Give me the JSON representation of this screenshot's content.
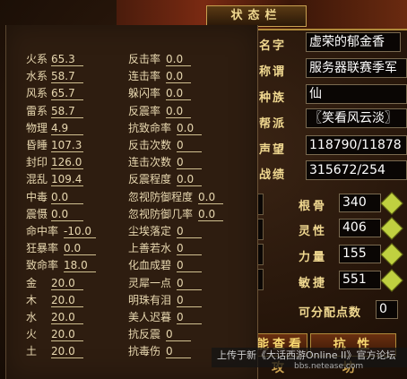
{
  "status_panel": {
    "title": "状态栏",
    "info": [
      {
        "label": "名字",
        "value": "虚荣的郁金香"
      },
      {
        "label": "称谓",
        "value": "服务器联赛季军"
      },
      {
        "label": "种族",
        "value": "仙"
      },
      {
        "label": "帮派",
        "value": "〖笑看风云淡〗"
      },
      {
        "label": "声望",
        "value": "118790/11878"
      },
      {
        "label": "战绩",
        "value": "315672/254"
      }
    ],
    "attributes": [
      {
        "label": "根骨",
        "value": "340"
      },
      {
        "label": "灵性",
        "value": "406"
      },
      {
        "label": "力量",
        "value": "155"
      },
      {
        "label": "敏捷",
        "value": "551"
      }
    ],
    "free_points": {
      "label": "可分配点数",
      "value": "0"
    },
    "buttons": {
      "view": "能查看",
      "resist": "抗 性"
    },
    "bottom_text": "攻 坊"
  },
  "resist_popup": {
    "left_column": [
      {
        "label": "火系",
        "value": "65.3"
      },
      {
        "label": "水系",
        "value": "58.7"
      },
      {
        "label": "风系",
        "value": "65.7"
      },
      {
        "label": "雷系",
        "value": "58.7"
      },
      {
        "label": "物理",
        "value": "4.9"
      },
      {
        "label": "昏睡",
        "value": "107.3"
      },
      {
        "label": "封印",
        "value": "126.0"
      },
      {
        "label": "混乱",
        "value": "109.4"
      },
      {
        "label": "中毒",
        "value": "0.0"
      },
      {
        "label": "震慑",
        "value": "0.0"
      },
      {
        "label": "命中率",
        "value": "-10.0"
      },
      {
        "label": "狂暴率",
        "value": "0.0"
      },
      {
        "label": "致命率",
        "value": "18.0"
      },
      {
        "label": "金",
        "value": "20.0"
      },
      {
        "label": "木",
        "value": "20.0"
      },
      {
        "label": "水",
        "value": "20.0"
      },
      {
        "label": "火",
        "value": "20.0"
      },
      {
        "label": "土",
        "value": "20.0"
      }
    ],
    "right_column": [
      {
        "label": "反击率",
        "value": "0.0"
      },
      {
        "label": "连击率",
        "value": "0.0"
      },
      {
        "label": "躲闪率",
        "value": "0.0"
      },
      {
        "label": "反震率",
        "value": "0.0"
      },
      {
        "label": "抗致命率",
        "value": "0.0"
      },
      {
        "label": "反击次数",
        "value": "0"
      },
      {
        "label": "连击次数",
        "value": "0"
      },
      {
        "label": "反震程度",
        "value": "0.0"
      },
      {
        "label": "忽视防御程度",
        "value": "0.0"
      },
      {
        "label": "忽视防御几率",
        "value": "0.0"
      },
      {
        "label": "尘埃落定",
        "value": "0"
      },
      {
        "label": "上善若水",
        "value": "0"
      },
      {
        "label": "化血成碧",
        "value": "0"
      },
      {
        "label": "灵犀一点",
        "value": "0"
      },
      {
        "label": "明珠有泪",
        "value": "0"
      },
      {
        "label": "美人迟暮",
        "value": "0"
      },
      {
        "label": "抗反震",
        "value": "0"
      },
      {
        "label": "抗毒伤",
        "value": "0"
      }
    ]
  },
  "watermark": {
    "line1": "上传于新《大话西游Online II》官方论坛",
    "line2": "bbs.netease.com"
  }
}
